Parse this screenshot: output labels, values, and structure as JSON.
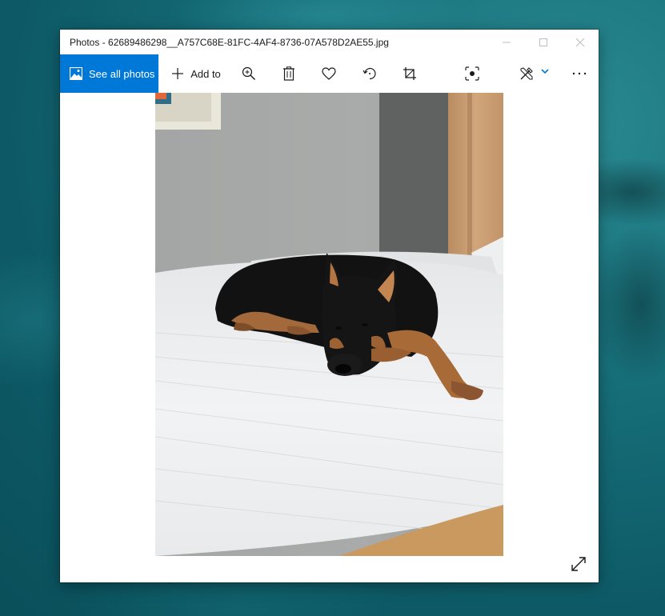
{
  "window": {
    "title": "Photos - 62689486298__A757C68E-81FC-4AF4-8736-07A578D2AE55.jpg",
    "minimize_glyph": "—",
    "maximize_glyph": "☐",
    "close_glyph": "✕"
  },
  "toolbar": {
    "see_all_label": "See all photos",
    "add_to_label": "Add to",
    "more_glyph": "···",
    "accent": "#0078d7"
  },
  "photo": {
    "subject": "black and tan dog lying on white bed"
  },
  "icons": [
    "picture-icon",
    "plus-icon",
    "zoom-in-icon",
    "delete-icon",
    "heart-icon",
    "rotate-icon",
    "crop-icon",
    "visual-search-icon",
    "edit-icon",
    "chevron-down-icon",
    "more-icon",
    "expand-icon"
  ]
}
